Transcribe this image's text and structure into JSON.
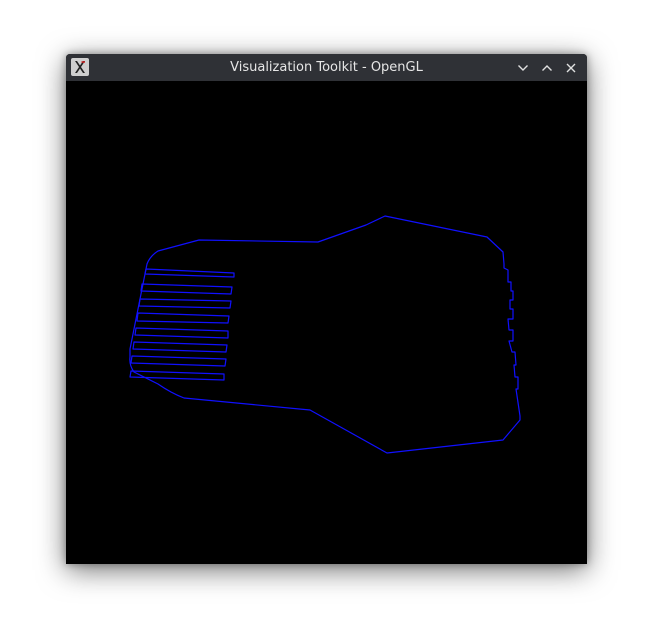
{
  "window": {
    "title": "Visualization Toolkit - OpenGL"
  },
  "titlebar": {
    "app_icon": "vtk-x-icon",
    "controls": [
      "minimize-icon",
      "maximize-icon",
      "close-icon"
    ]
  },
  "viewport": {
    "background_color": "#000000",
    "outline_color": "#0000ff",
    "content": "wireframe-outline"
  }
}
